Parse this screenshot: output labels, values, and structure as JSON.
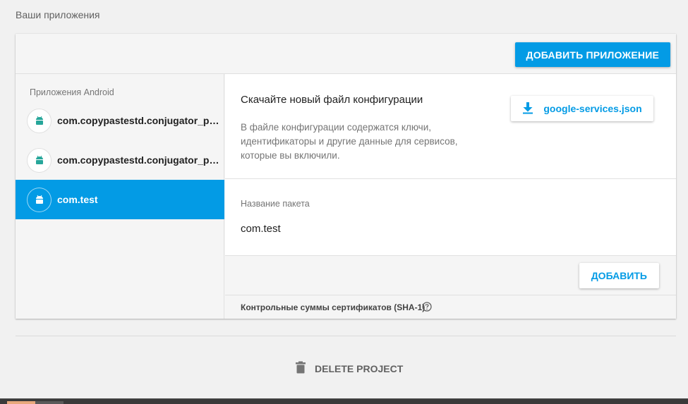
{
  "section_title": "Ваши приложения",
  "header": {
    "add_app_label": "ДОБАВИТЬ ПРИЛОЖЕНИЕ"
  },
  "sidebar": {
    "heading": "Приложения Android",
    "items": [
      {
        "label": "com.copypastestd.conjugator_pt.f...",
        "icon": "android-icon",
        "selected": false
      },
      {
        "label": "com.copypastestd.conjugator_pt.f...",
        "icon": "android-icon",
        "selected": false
      },
      {
        "label": "com.test",
        "icon": "android-icon",
        "selected": true
      }
    ]
  },
  "download": {
    "title": "Скачайте новый файл конфигурации",
    "description": "В файле конфигурации содержатся ключи, идентификаторы и другие данные для сервисов, которые вы включили.",
    "button_label": "google-services.json",
    "button_icon": "download-icon"
  },
  "package": {
    "label": "Название пакета",
    "value": "com.test"
  },
  "add": {
    "button_label": "ДОБАВИТЬ"
  },
  "sha": {
    "label": "Контрольные суммы сертификатов (SHA-1)",
    "icon": "help-icon"
  },
  "footer": {
    "delete_label": "DELETE PROJECT",
    "delete_icon": "trash-icon"
  },
  "colors": {
    "accent": "#039be5",
    "background": "#f1f1f1",
    "android_green": "#26a69a"
  }
}
